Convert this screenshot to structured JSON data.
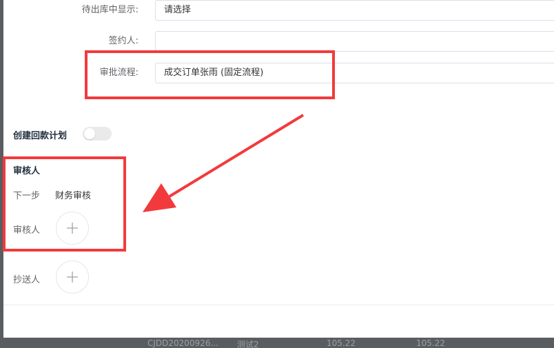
{
  "form": {
    "rows": [
      {
        "label": "待出库中显示:",
        "value": "请选择"
      },
      {
        "label": "签约人:",
        "value": ""
      },
      {
        "label": "审批流程:",
        "value": "成交订单张雨 (固定流程)"
      }
    ]
  },
  "repayment": {
    "label": "创建回款计划",
    "enabled": false
  },
  "reviewer": {
    "title": "审核人",
    "next_step_label": "下一步",
    "next_step_value": "财务审核",
    "reviewer_label": "审核人",
    "cc_label": "抄送人"
  },
  "background_row": {
    "code": "CJDD20200926...",
    "link": "测试2",
    "amount1": "105.22",
    "amount2": "105.22"
  },
  "icons": {
    "add": "plus-icon",
    "arrow": "annotation-arrow"
  },
  "colors": {
    "annotation": "#f23a3c",
    "overlay": "#5a5d60"
  }
}
